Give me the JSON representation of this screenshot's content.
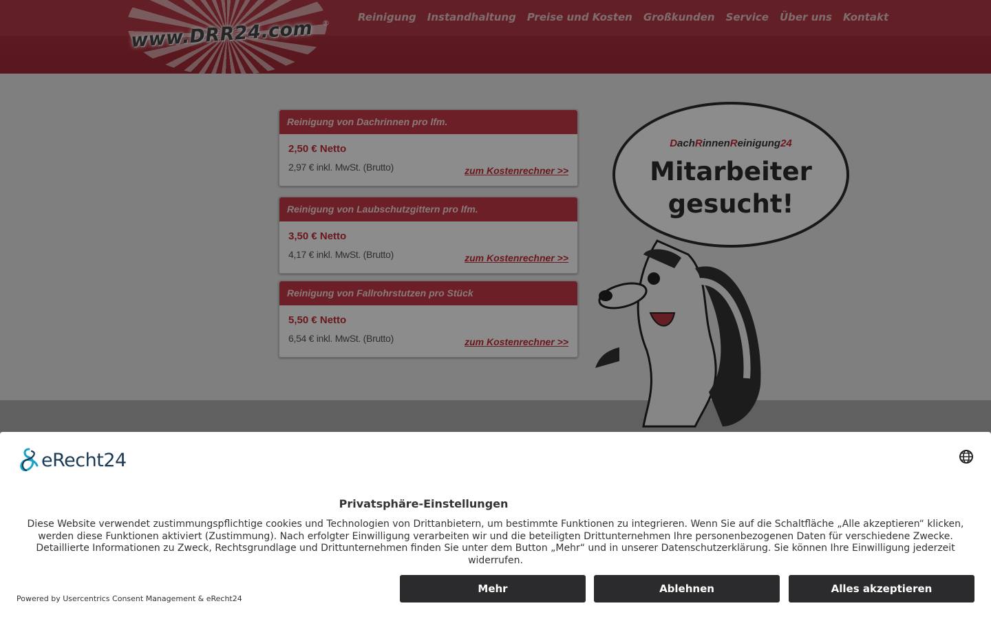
{
  "header": {
    "logo_text": "www.DRR24.com",
    "logo_reg": "®",
    "nav": [
      "Reinigung",
      "Instandhaltung",
      "Preise und Kosten",
      "Großkunden",
      "Service",
      "Über uns",
      "Kontakt"
    ]
  },
  "cards": [
    {
      "title": "Reinigung von Dachrinnen pro lfm.",
      "net": "2,50 € Netto",
      "gross": "2,97 € inkl. MwSt. (Brutto)",
      "link": "zum Kostenrechner >>"
    },
    {
      "title": "Reinigung von Laubschutzgittern pro lfm.",
      "net": "3,50 € Netto",
      "gross": "4,17 € inkl. MwSt. (Brutto)",
      "link": "zum Kostenrechner >>"
    },
    {
      "title": "Reinigung von Fallrohrstutzen pro Stück",
      "net": "5,50 € Netto",
      "gross": "6,54 € inkl. MwSt. (Brutto)",
      "link": "zum Kostenrechner >>"
    }
  ],
  "mascot": {
    "brand_parts": [
      "D",
      "ach",
      "R",
      "innen",
      "R",
      "einigung",
      "24"
    ],
    "title_line1": "Mitarbeiter",
    "title_line2": "gesucht!"
  },
  "consent": {
    "logo_text": "eRecht24",
    "title": "Privatsphäre-Einstellungen",
    "text": "Diese Website verwendet zustimmungspflichtige cookies und Technologien von Drittanbietern, um bestimmte Funktionen zu integrieren. Wenn Sie auf die Schaltfläche „Alle akzeptieren“ klicken, werden diese Funktionen aktiviert (Zustimmung). Nach erfolgter Einwilligung verarbeiten wir und die beteiligten Drittunternehmen Ihre personenbezogenen Daten für verschiedene Zwecke. Detaillierte Informationen zu Zweck, Rechtsgrundlage und Drittunternehmen finden Sie unter dem Button „Mehr“ und in unserer Datenschutzerklärung. Sie können Ihre Einwilligung jederzeit widerrufen.",
    "powered": "Powered by Usercentrics Consent Management & eRecht24",
    "buttons": {
      "more": "Mehr",
      "decline": "Ablehnen",
      "accept": "Alles akzeptieren"
    },
    "icons": {
      "language": "globe-icon",
      "logo": "erecht24-logo-icon"
    }
  },
  "colors": {
    "brand_red": "#c73a47",
    "header_red": "#b53a45",
    "button_dark": "#2b2b2d"
  }
}
